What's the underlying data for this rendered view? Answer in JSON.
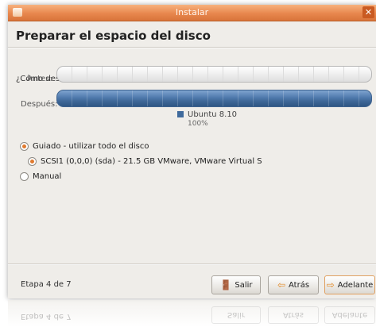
{
  "window": {
    "title": "Instalar",
    "close_glyph": "✕"
  },
  "page": {
    "heading": "Preparar el espacio del disco",
    "question": "¿Cómo desea particionar el disco?"
  },
  "partition": {
    "before_label": "Antes:",
    "after_label": "Después:",
    "after_fill_fraction": 1.0,
    "legend": {
      "name": "Ubuntu 8.10",
      "percent": "100%",
      "color": "#3f6a9c"
    }
  },
  "options": {
    "guided": "Guiado - utilizar todo el disco",
    "disk": "SCSI1 (0,0,0) (sda) - 21.5 GB VMware, VMware Virtual S",
    "manual": "Manual"
  },
  "footer": {
    "step": "Etapa 4 de 7",
    "quit_label": "Salir",
    "back_label": "Atrás",
    "forward_label": "Adelante"
  },
  "icons": {
    "quit": "exit-door-icon",
    "back": "arrow-left-icon",
    "forward": "arrow-right-icon"
  },
  "colors": {
    "titlebar": "#e8874e",
    "accent": "#e07a2f",
    "partition_bar": "#4f79ac"
  }
}
